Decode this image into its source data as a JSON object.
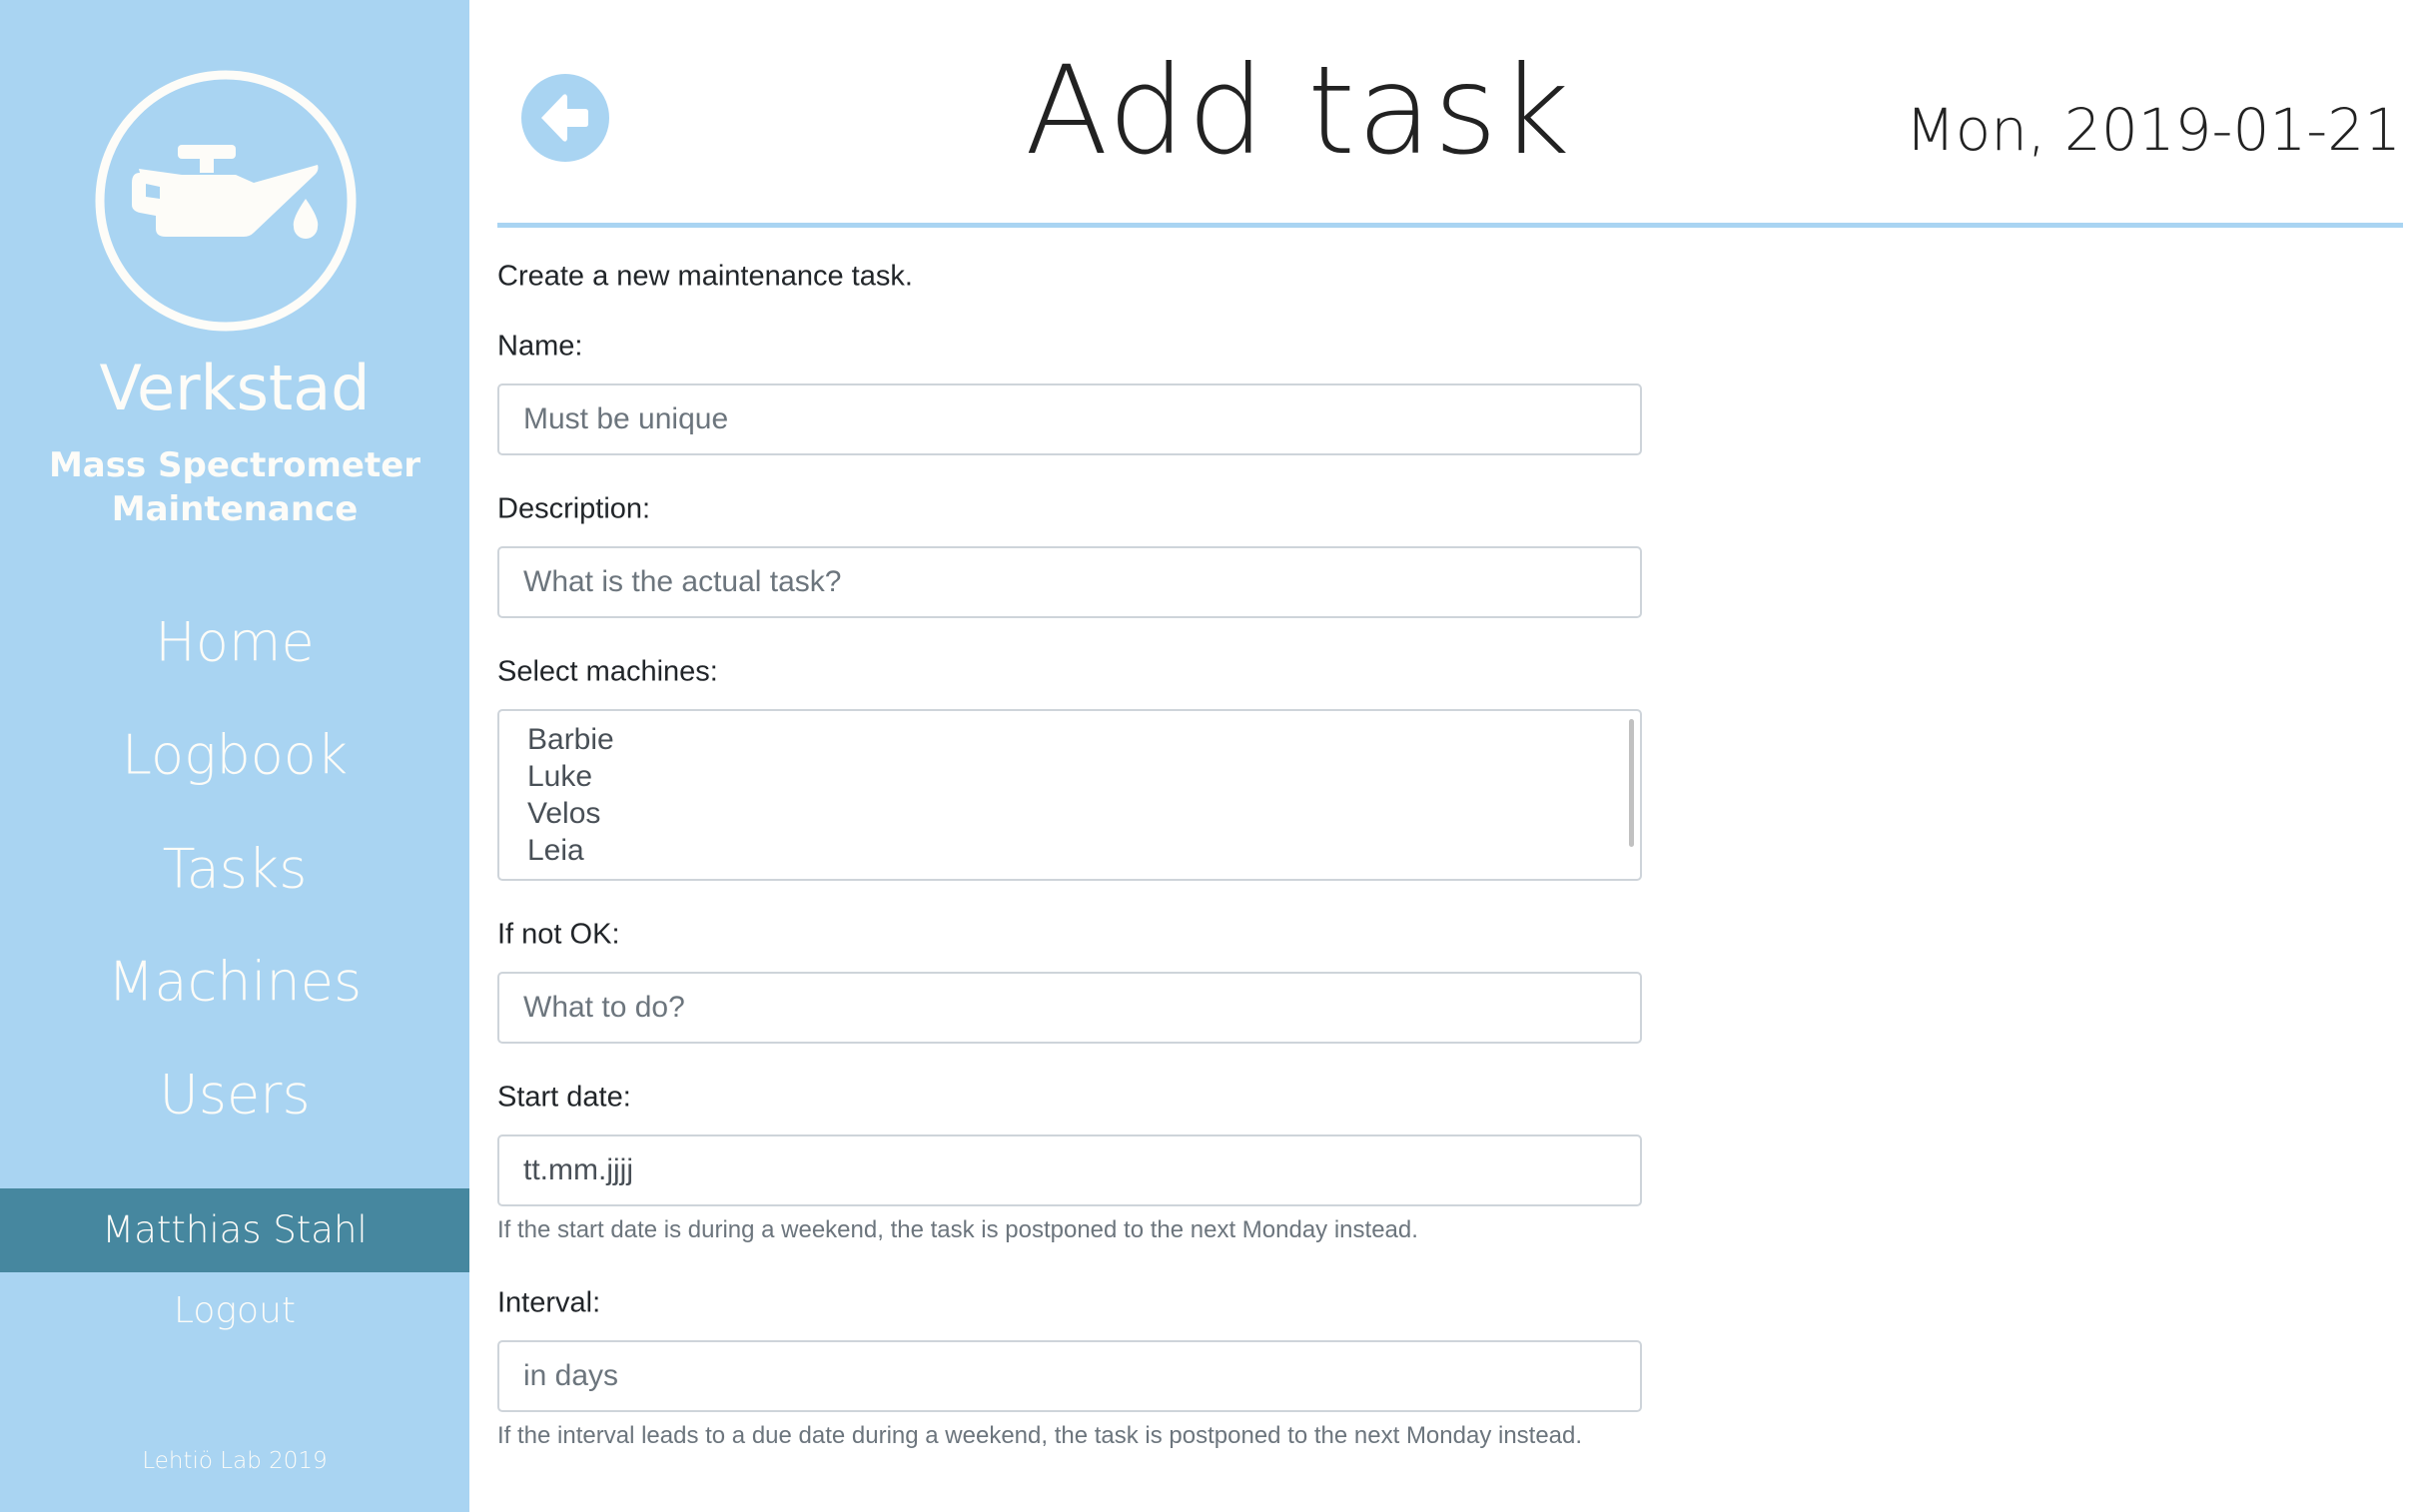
{
  "sidebar": {
    "brand": "Verkstad",
    "subtitle_line1": "Mass Spectrometer",
    "subtitle_line2": "Maintenance",
    "nav": [
      {
        "label": "Home"
      },
      {
        "label": "Logbook"
      },
      {
        "label": "Tasks"
      },
      {
        "label": "Machines"
      },
      {
        "label": "Users"
      }
    ],
    "user": "Matthias Stahl",
    "logout": "Logout",
    "footer": "Lehtiö Lab 2019",
    "icon": "oil-can-icon"
  },
  "header": {
    "title": "Add task",
    "date": "Mon, 2019-01-21",
    "back_icon": "arrow-left-circle-icon"
  },
  "form": {
    "intro": "Create a new maintenance task.",
    "name_label": "Name:",
    "name_placeholder": "Must be unique",
    "description_label": "Description:",
    "description_placeholder": "What is the actual task?",
    "machines_label": "Select machines:",
    "machines": [
      "Barbie",
      "Luke",
      "Velos",
      "Leia"
    ],
    "ifnotok_label": "If not OK:",
    "ifnotok_placeholder": "What to do?",
    "startdate_label": "Start date:",
    "startdate_value": "tt.mm.jjjj",
    "startdate_help": "If the start date is during a weekend, the task is postponed to the next Monday instead.",
    "interval_label": "Interval:",
    "interval_placeholder": "in days",
    "interval_help": "If the interval leads to a due date during a weekend, the task is postponed to the next Monday instead."
  },
  "colors": {
    "sidebar": "#a9d4f2",
    "user_bar": "#46879f",
    "text_light": "#fdfcf8"
  }
}
